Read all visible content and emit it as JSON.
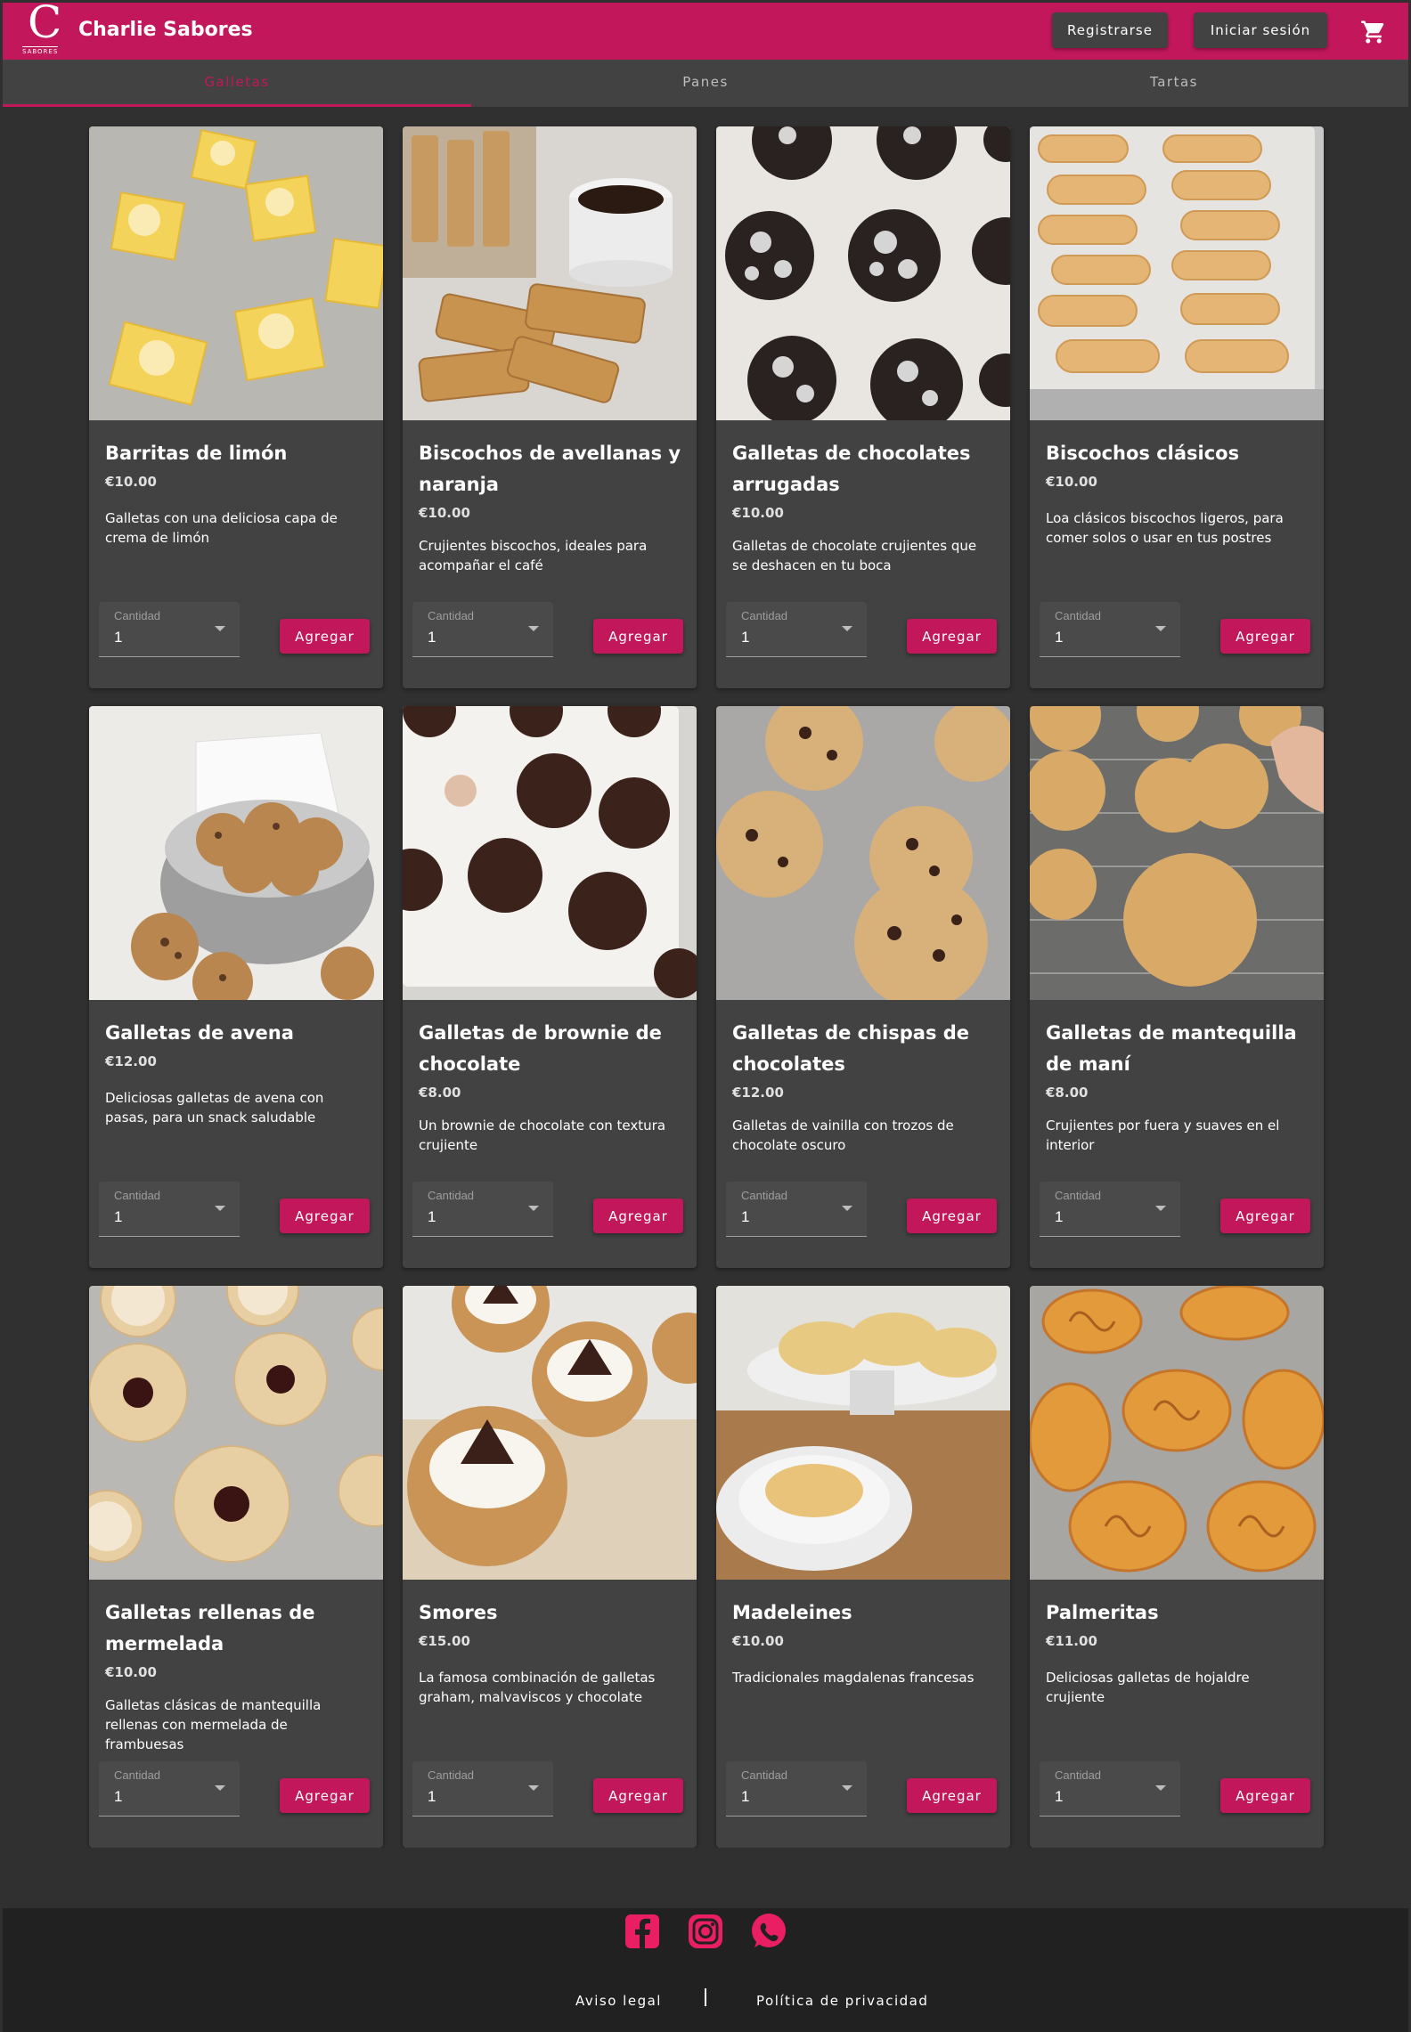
{
  "header": {
    "brand": "Charlie Sabores",
    "logo_letter": "C",
    "logo_sub": "SABORES",
    "register_label": "Registrarse",
    "login_label": "Iniciar sesión",
    "accent_color": "#c2185b"
  },
  "tabs": [
    {
      "label": "Galletas",
      "active": true
    },
    {
      "label": "Panes",
      "active": false
    },
    {
      "label": "Tartas",
      "active": false
    }
  ],
  "products": [
    {
      "name": "Barritas de limón",
      "price": "€10.00",
      "description": "Galletas con una deliciosa capa de crema de limón",
      "qty_label": "Cantidad",
      "qty": "1",
      "add_label": "Agregar",
      "image": "lemon bars"
    },
    {
      "name": "Biscochos de avellanas y naranja",
      "price": "€10.00",
      "description": "Crujientes biscochos, ideales para acompañar el café",
      "qty_label": "Cantidad",
      "qty": "1",
      "add_label": "Agregar",
      "image": "biscotti and coffee"
    },
    {
      "name": "Galletas de chocolates arrugadas",
      "price": "€10.00",
      "description": "Galletas de chocolate crujientes que se deshacen en tu boca",
      "qty_label": "Cantidad",
      "qty": "1",
      "add_label": "Agregar",
      "image": "chocolate crinkle cookies"
    },
    {
      "name": "Biscochos clásicos",
      "price": "€10.00",
      "description": "Loa clásicos biscochos ligeros, para comer solos o usar en tus postres",
      "qty_label": "Cantidad",
      "qty": "1",
      "add_label": "Agregar",
      "image": "ladyfingers on tray"
    },
    {
      "name": "Galletas de avena",
      "price": "€12.00",
      "description": "Deliciosas galletas de avena con pasas, para un snack saludable",
      "qty_label": "Cantidad",
      "qty": "1",
      "add_label": "Agregar",
      "image": "oatmeal cookies in tin"
    },
    {
      "name": "Galletas de brownie de chocolate",
      "price": "€8.00",
      "description": "Un brownie de chocolate con textura crujiente",
      "qty_label": "Cantidad",
      "qty": "1",
      "add_label": "Agregar",
      "image": "brownie cookies on sheet"
    },
    {
      "name": "Galletas de chispas de chocolates",
      "price": "€12.00",
      "description": "Galletas de vainilla con trozos de chocolate oscuro",
      "qty_label": "Cantidad",
      "qty": "1",
      "add_label": "Agregar",
      "image": "chocolate chip cookies"
    },
    {
      "name": "Galletas de mantequilla de maní",
      "price": "€8.00",
      "description": "Crujientes por fuera y suaves en el interior",
      "qty_label": "Cantidad",
      "qty": "1",
      "add_label": "Agregar",
      "image": "peanut butter cookies on rack"
    },
    {
      "name": "Galletas rellenas de mermelada",
      "price": "€10.00",
      "description": "Galletas clásicas de mantequilla rellenas con mermelada de frambuesas",
      "qty_label": "Cantidad",
      "qty": "1",
      "add_label": "Agregar",
      "image": "linzer cookies"
    },
    {
      "name": "Smores",
      "price": "€15.00",
      "description": "La famosa combinación de galletas graham, malvaviscos y chocolate",
      "qty_label": "Cantidad",
      "qty": "1",
      "add_label": "Agregar",
      "image": "smores cookies"
    },
    {
      "name": "Madeleines",
      "price": "€10.00",
      "description": "Tradicionales magdalenas francesas",
      "qty_label": "Cantidad",
      "qty": "1",
      "add_label": "Agregar",
      "image": "madeleines on plates"
    },
    {
      "name": "Palmeritas",
      "price": "€11.00",
      "description": "Deliciosas galletas de hojaldre crujiente",
      "qty_label": "Cantidad",
      "qty": "1",
      "add_label": "Agregar",
      "image": "palmier cookies"
    }
  ],
  "footer": {
    "legal_label": "Aviso legal",
    "privacy_label": "Política de privacidad",
    "social_icons": [
      "facebook-icon",
      "instagram-icon",
      "whatsapp-icon"
    ]
  }
}
